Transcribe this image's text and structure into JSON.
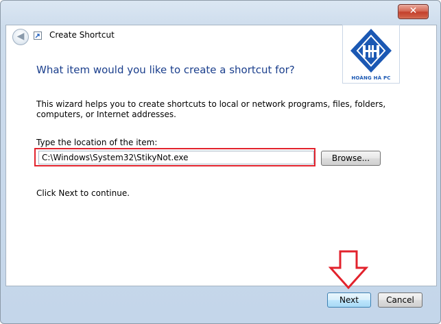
{
  "window": {
    "title": "Create Shortcut",
    "close_glyph": "✕"
  },
  "header": {
    "back_glyph": "◀",
    "heading": "What item would you like to create a shortcut for?"
  },
  "logo": {
    "text": "HOÀNG HÀ PC",
    "primary_color": "#1b58b3"
  },
  "body": {
    "description": "This wizard helps you to create shortcuts to local or network programs, files, folders, computers, or Internet addresses.",
    "location_label": "Type the location of the item:",
    "location_value": "C:\\Windows\\System32\\StikyNot.exe",
    "browse_label": "Browse...",
    "continue_text": "Click Next to continue."
  },
  "footer": {
    "next_label": "Next",
    "cancel_label": "Cancel"
  },
  "annotations": {
    "highlight_color": "#e2222c",
    "arrow_icon": "down-arrow-icon"
  }
}
